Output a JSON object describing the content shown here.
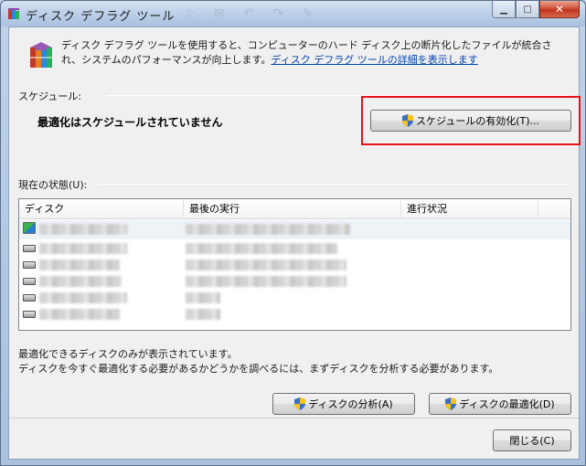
{
  "window": {
    "title": "ディスク デフラグ ツール",
    "ghost_toolbar": "☆ ✉ ↶ ↷ ✎"
  },
  "titlebar_buttons": {
    "minimize": "▁",
    "maximize": "□",
    "close": "✕"
  },
  "intro": {
    "text": "ディスク デフラグ ツールを使用すると、コンピューターのハード ディスク上の断片化したファイルが統合され、システムのパフォーマンスが向上します。",
    "link": "ディスク デフラグ ツールの詳細を表示します"
  },
  "schedule": {
    "section_label": "スケジュール:",
    "status": "最適化はスケジュールされていません",
    "enable_button": "スケジュールの有効化(T)..."
  },
  "current_state": {
    "section_label": "現在の状態(U):",
    "columns": [
      "ディスク",
      "最後の実行",
      "進行状況"
    ],
    "rows": [
      {
        "icon": "windows-drive-icon",
        "selected": true
      },
      {
        "icon": "hard-drive-icon",
        "selected": false
      },
      {
        "icon": "hard-drive-icon",
        "selected": false
      },
      {
        "icon": "hard-drive-icon",
        "selected": false
      },
      {
        "icon": "hard-drive-icon",
        "selected": false
      },
      {
        "icon": "hard-drive-icon",
        "selected": false
      }
    ]
  },
  "info": {
    "line1": "最適化できるディスクのみが表示されています。",
    "line2": "ディスクを今すぐ最適化する必要があるかどうかを調べるには、まずディスクを分析する必要があります。"
  },
  "actions": {
    "analyze": "ディスクの分析(A)",
    "defrag": "ディスクの最適化(D)",
    "close": "閉じる(C)"
  },
  "colors": {
    "highlight_box": "#e8111a",
    "link": "#0645ad"
  }
}
